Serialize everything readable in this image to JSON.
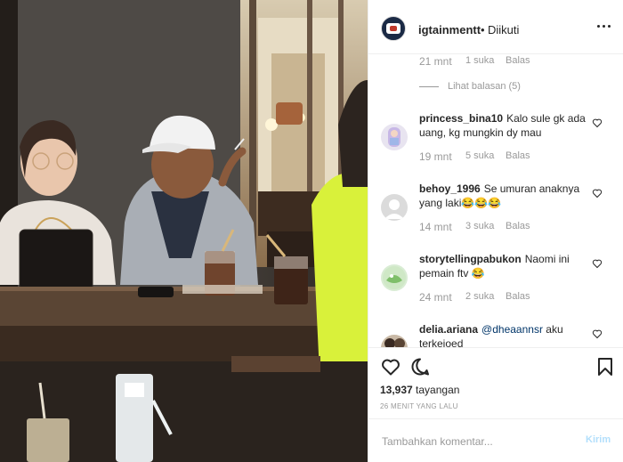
{
  "post": {
    "username": "igtainmentt",
    "separator": "•",
    "follow_status": "Diikuti",
    "more_icon": "more-horizontal-icon"
  },
  "comments": {
    "partial_first": {
      "time": "21 mnt",
      "likes": "1 suka",
      "reply": "Balas"
    },
    "view_replies": "Lihat balasan (5)",
    "items": [
      {
        "user": "princess_bina10",
        "text": "Kalo sule gk ada uang, kg mungkin dy mau",
        "time": "19 mnt",
        "likes": "5 suka",
        "reply": "Balas"
      },
      {
        "user": "behoy_1996",
        "text": "Se umuran anaknya yang laki😂😂😂",
        "time": "14 mnt",
        "likes": "3 suka",
        "reply": "Balas"
      },
      {
        "user": "storytellingpabukon",
        "text": "Naomi ini pemain ftv 😂",
        "time": "24 mnt",
        "likes": "2 suka",
        "reply": "Balas"
      },
      {
        "user": "delia.ariana",
        "mention": "@dheaannsr",
        "text": "aku terkeioed"
      }
    ]
  },
  "actions": {
    "like_icon": "heart-icon",
    "comment_icon": "comment-icon",
    "save_icon": "bookmark-icon",
    "views_count": "13,937",
    "views_label": "tayangan",
    "posted_ago": "26 MENIT YANG LALU"
  },
  "add_comment": {
    "placeholder": "Tambahkan komentar...",
    "post_label": "Kirim"
  },
  "colors": {
    "link": "#003569",
    "muted": "#999999",
    "post_disabled": "#b2dffc"
  }
}
